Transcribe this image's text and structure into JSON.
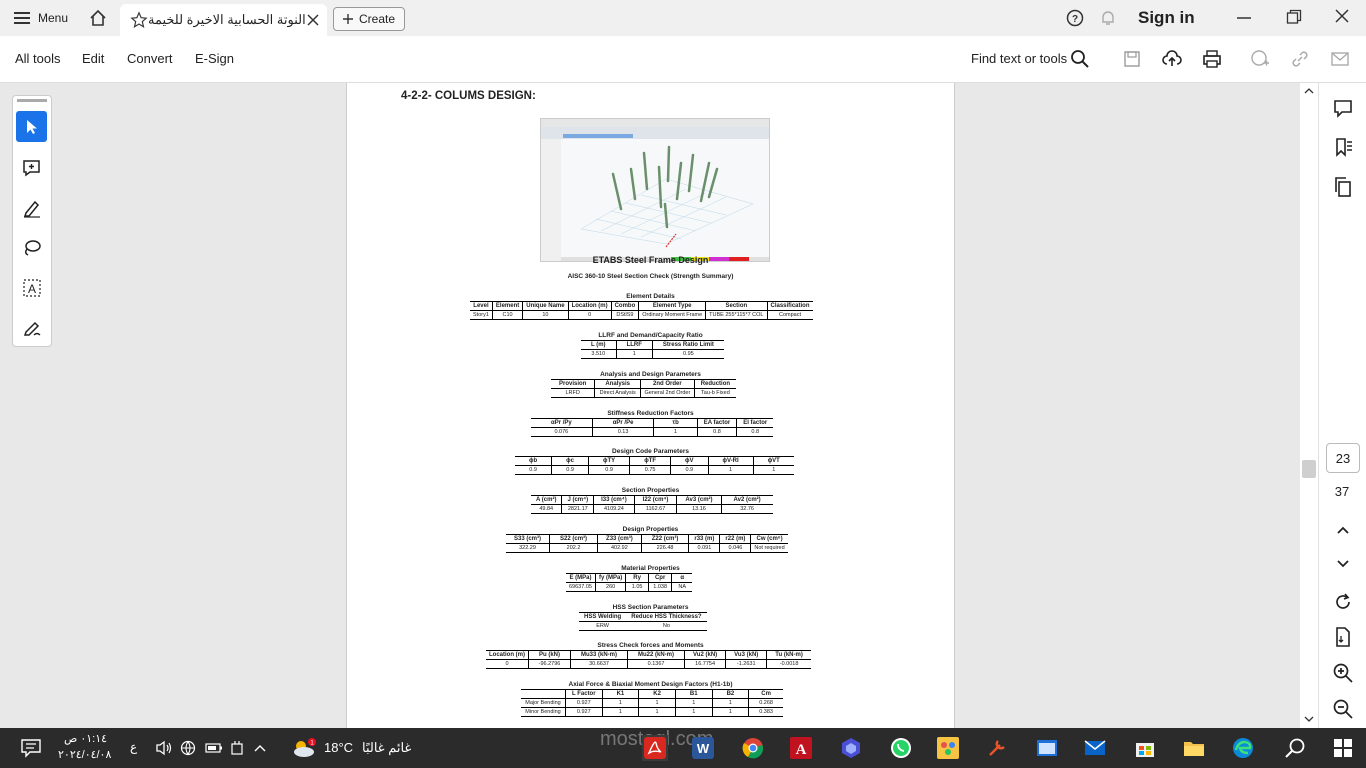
{
  "titlebar": {
    "menu_label": "Menu",
    "tab_title": "النوتة الحسابية الاخيرة للخيمة...",
    "create_label": "Create",
    "sign_in": "Sign in"
  },
  "toolbar": {
    "items": [
      "All tools",
      "Edit",
      "Convert",
      "E-Sign"
    ],
    "find_label": "Find text or tools"
  },
  "document": {
    "heading": "4-2-2- COLUMS DESIGN:",
    "report_title": "ETABS Steel Frame Design",
    "report_subtitle": "AISC 360-10 Steel Section Check (Strength Summary)",
    "element_details": {
      "title": "Element Details",
      "headers": [
        "Level",
        "Element",
        "Unique Name",
        "Location (m)",
        "Combo",
        "Element Type",
        "Section",
        "Classification"
      ],
      "row": [
        "Story1",
        "C10",
        "10",
        "0",
        "DStlS9",
        "Ordinary Moment Frame",
        "TUBE 255*115*7 COL",
        "Compact"
      ]
    },
    "llrf": {
      "title": "LLRF and Demand/Capacity Ratio",
      "headers": [
        "L (m)",
        "LLRF",
        "Stress Ratio Limit"
      ],
      "row": [
        "3.510",
        "1",
        "0.95"
      ]
    },
    "analysis": {
      "title": "Analysis and Design Parameters",
      "headers": [
        "Provision",
        "Analysis",
        "2nd Order",
        "Reduction"
      ],
      "row": [
        "LRFD",
        "Direct Analysis",
        "General 2nd Order",
        "Tau-b Fixed"
      ]
    },
    "stiffness": {
      "title": "Stiffness Reduction Factors",
      "headers": [
        "αPr /Py",
        "αPr /Pe",
        "τb",
        "EA factor",
        "EI factor"
      ],
      "row": [
        "0.076",
        "0.13",
        "1",
        "0.8",
        "0.8"
      ]
    },
    "design_code": {
      "title": "Design Code Parameters",
      "headers": [
        "ϕb",
        "ϕc",
        "ϕTY",
        "ϕTF",
        "ϕV",
        "ϕV-RI",
        "ϕVT"
      ],
      "row": [
        "0.9",
        "0.9",
        "0.9",
        "0.75",
        "0.9",
        "1",
        "1"
      ]
    },
    "section_props": {
      "title": "Section Properties",
      "headers": [
        "A (cm²)",
        "J (cm⁴)",
        "I33 (cm⁴)",
        "I22 (cm⁴)",
        "Av3 (cm²)",
        "Av2 (cm²)"
      ],
      "row": [
        "49.84",
        "2821.17",
        "4109.24",
        "1162.67",
        "13.16",
        "32.76"
      ]
    },
    "design_props": {
      "title": "Design Properties",
      "headers": [
        "S33 (cm³)",
        "S22 (cm³)",
        "Z33 (cm³)",
        "Z22 (cm³)",
        "r33 (m)",
        "r22 (m)",
        "Cw (cm⁶)"
      ],
      "row": [
        "322.29",
        "202.2",
        "402.92",
        "226.48",
        "0.091",
        "0.046",
        "Not required"
      ]
    },
    "material": {
      "title": "Material Properties",
      "headers": [
        "E (MPa)",
        "fy (MPa)",
        "Ry",
        "Cpr",
        "α"
      ],
      "row": [
        "69637.05",
        "260",
        "1.05",
        "1.038",
        "NA"
      ]
    },
    "hss": {
      "title": "HSS Section Parameters",
      "headers": [
        "HSS Welding",
        "Reduce HSS Thickness?"
      ],
      "row": [
        "ERW",
        "No"
      ]
    },
    "stress": {
      "title": "Stress Check forces and Moments",
      "headers": [
        "Location (m)",
        "Pu (kN)",
        "Mu33 (kN-m)",
        "Mu22 (kN-m)",
        "Vu2 (kN)",
        "Vu3 (kN)",
        "Tu (kN-m)"
      ],
      "row": [
        "0",
        "-96.2796",
        "30.6637",
        "0.1367",
        "16.7754",
        "-1.2631",
        "-0.0018"
      ]
    },
    "axial": {
      "title": "Axial Force & Biaxial Moment Design Factors  (H1-1b)",
      "headers": [
        "",
        "L Factor",
        "K1",
        "K2",
        "B1",
        "B2",
        "Cm"
      ],
      "rows": [
        [
          "Major Bending",
          "0.927",
          "1",
          "1",
          "1",
          "1",
          "0.268"
        ],
        [
          "Minor Bending",
          "0.927",
          "1",
          "1",
          "1",
          "1",
          "0.383"
        ]
      ]
    }
  },
  "pager": {
    "current": "23",
    "total": "37"
  },
  "taskbar": {
    "time": "٠١:١٤ ص",
    "date": "٢٠٢٤/٠٤/٠٨",
    "keyboard": "ع",
    "weather_temp": "18°C",
    "weather_text": "غائم غالبًا",
    "weather_badge": "1"
  },
  "watermark": "mostaql.com",
  "colors": {
    "accent": "#1a73e8",
    "acrobat_red": "#d9281f",
    "taskbar": "#2b2b2b"
  }
}
